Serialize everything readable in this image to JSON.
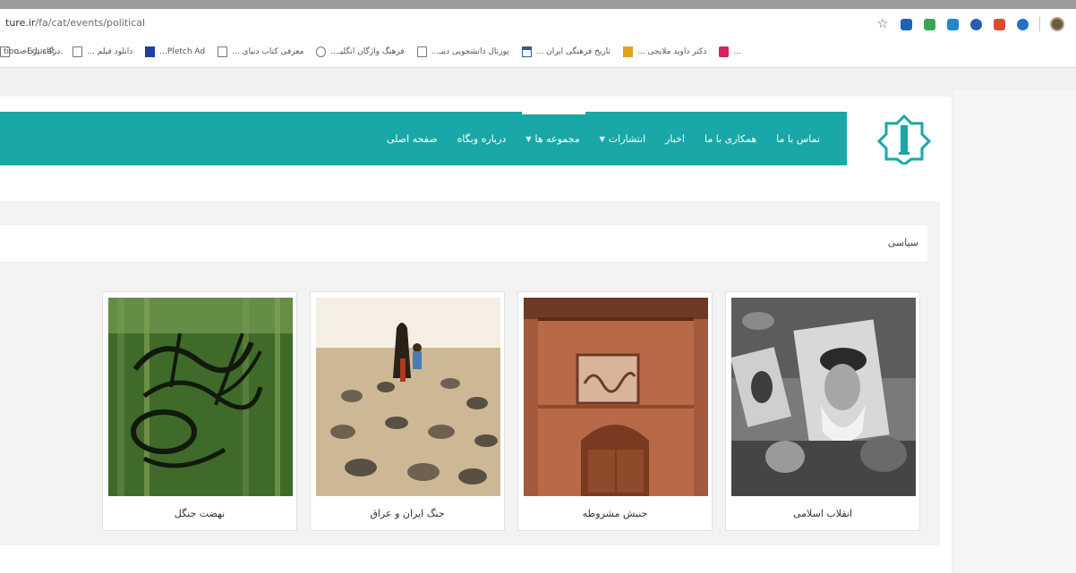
{
  "browser": {
    "url_host": "ture.ir",
    "url_path": "/fa/cat/events/political",
    "extensions": [
      {
        "name": "star-icon",
        "color": "#555555"
      },
      {
        "name": "extension-icon-1",
        "color": "#1e63b8"
      },
      {
        "name": "extension-icon-2",
        "color": "#3aa655"
      },
      {
        "name": "extension-icon-3",
        "color": "#1f8ac9"
      },
      {
        "name": "extension-icon-4",
        "color": "#2a5db0"
      },
      {
        "name": "extension-icon-5",
        "color": "#e04b2e"
      },
      {
        "name": "extension-icon-6",
        "color": "#2372c7"
      }
    ],
    "bookmarks": [
      {
        "label": "درگاه پرداخت",
        "icon": "page"
      },
      {
        "label": "دانلود فیلم ...",
        "icon": "page"
      },
      {
        "label": "Pletch Ad...",
        "icon": "blue"
      },
      {
        "label": "معرفی کتاب دنیای ...",
        "icon": "page"
      },
      {
        "label": "فرهنگ واژگان انگلیـ...",
        "icon": "globe"
      },
      {
        "label": "پورتال دانشجویی دیبـ...",
        "icon": "page"
      },
      {
        "label": "تاریخ فرهنگی ایران ...",
        "icon": "house"
      },
      {
        "label": "دکتر داوید ملایجی ...",
        "icon": "orange"
      },
      {
        "label": "...",
        "icon": "pink"
      }
    ],
    "bookmarks_overflow": "tion - Educat..."
  },
  "site": {
    "nav": [
      {
        "label": "صفحه اصلی",
        "caret": false,
        "active": false
      },
      {
        "label": "درباره وبگاه",
        "caret": false,
        "active": false
      },
      {
        "label": "مجموعه ها",
        "caret": true,
        "active": true
      },
      {
        "label": "انتشارات",
        "caret": true,
        "active": false
      },
      {
        "label": "اخبار",
        "caret": false,
        "active": false
      },
      {
        "label": "همکاری با ما",
        "caret": false,
        "active": false
      },
      {
        "label": "تماس با ما",
        "caret": false,
        "active": false
      }
    ],
    "breadcrumb": "سیاسی",
    "cards": [
      {
        "caption": "انقلاب اسلامی",
        "image": "revolution-photo"
      },
      {
        "caption": "جنبش مشروطه",
        "image": "constitution-door-photo"
      },
      {
        "caption": "جنگ ایران و عراق",
        "image": "iran-iraq-war-photo"
      },
      {
        "caption": "نهضت جنگل",
        "image": "jungle-movement-calligraphy"
      }
    ],
    "colors": {
      "primary": "#1aa7a7",
      "nav_text": "#ffffff"
    }
  }
}
